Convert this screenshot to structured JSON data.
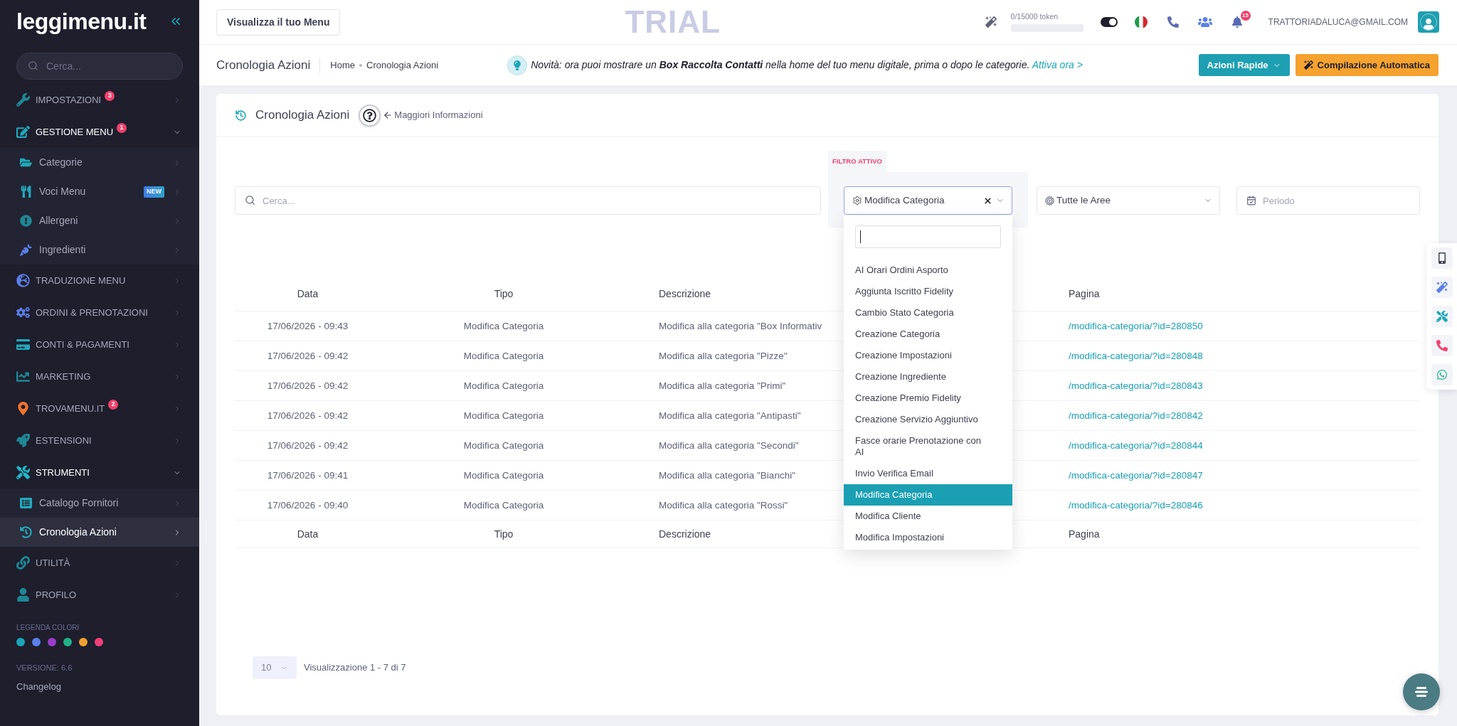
{
  "sidebar": {
    "logo": "leggimenu.it",
    "search": {
      "placeholder": "Cerca..."
    },
    "items": [
      {
        "label": "IMPOSTAZIONI",
        "badge": "3",
        "expanded": false
      },
      {
        "label": "GESTIONE MENU",
        "badge": "1",
        "expanded": true,
        "children": [
          {
            "label": "Categorie",
            "selected": false
          },
          {
            "label": "Voci Menu",
            "tag": "NEW",
            "selected": false
          },
          {
            "label": "Allergeni",
            "selected": false
          },
          {
            "label": "Ingredienti",
            "selected": false
          }
        ]
      },
      {
        "label": "TRADUZIONE MENU",
        "expanded": false
      },
      {
        "label": "ORDINI & PRENOTAZIONI",
        "expanded": false
      },
      {
        "label": "CONTI & PAGAMENTI",
        "expanded": false
      },
      {
        "label": "MARKETING",
        "expanded": false
      },
      {
        "label": "TROVAMENU.IT",
        "badge": "2",
        "expanded": false
      },
      {
        "label": "ESTENSIONI",
        "expanded": false
      },
      {
        "label": "STRUMENTI",
        "expanded": true,
        "children": [
          {
            "label": "Catalogo Fornitori",
            "selected": false
          },
          {
            "label": "Cronologia Azioni",
            "selected": true
          }
        ]
      },
      {
        "label": "UTILITÀ",
        "expanded": false
      },
      {
        "label": "PROFILO",
        "expanded": false
      }
    ],
    "legend": {
      "title": "LEGENDA COLORI",
      "colors": [
        {
          "color": "#1ba5b8"
        },
        {
          "color": "#5b7fe8"
        },
        {
          "color": "#9b3cc9"
        },
        {
          "color": "#22b38a"
        },
        {
          "color": "#f0a030"
        },
        {
          "color": "#f0407a"
        }
      ]
    },
    "version": "VERSIONE: 6.6",
    "changelog": "Changelog"
  },
  "top_bar": {
    "view_menu_button": "Visualizza il tuo Menu",
    "trial_label": "TRIAL",
    "tokens": {
      "text": "0/15000 token"
    },
    "theme_toggle": {
      "on": true
    },
    "notifications": {
      "badge": "15"
    },
    "user_email": "TRATTORIADALUCA@GMAIL.COM"
  },
  "sub_header": {
    "title": "Cronologia Azioni",
    "breadcrumbs": [
      "Home",
      "Cronologia Azioni"
    ],
    "notice": {
      "text": "Novità: ora puoi mostrare un **Box Raccolta Contatti** nella home del tuo menu digitale, prima o dopo le categorie.",
      "link": "Attiva ora >"
    },
    "actions": [
      {
        "label": "Azioni Rapide",
        "kind": "dropdown"
      },
      {
        "label": "Compilazione Automatica",
        "kind": "magic"
      }
    ]
  },
  "card": {
    "title": "Cronologia Azioni",
    "help_link": "Maggiori Informazioni",
    "filters": {
      "search": {
        "placeholder": "Cerca..."
      },
      "active_label": "FILTRO ATTIVO",
      "type_select": {
        "value": "Modifica Categoria",
        "open": true,
        "options": [
          {
            "label": "AI Orari Ordini Asporto",
            "selected": false
          },
          {
            "label": "Aggiunta Iscritto Fidelity",
            "selected": false
          },
          {
            "label": "Cambio Stato Categoria",
            "selected": false
          },
          {
            "label": "Creazione Categoria",
            "selected": false
          },
          {
            "label": "Creazione Impostazioni",
            "selected": false
          },
          {
            "label": "Creazione Ingrediente",
            "selected": false
          },
          {
            "label": "Creazione Premio Fidelity",
            "selected": false
          },
          {
            "label": "Creazione Servizio Aggiuntivo",
            "selected": false
          },
          {
            "label": "Fasce orarie Prenotazione con AI",
            "selected": false
          },
          {
            "label": "Invio Verifica Email",
            "selected": false
          },
          {
            "label": "Modifica Categoria",
            "selected": true
          },
          {
            "label": "Modifica Cliente",
            "selected": false
          },
          {
            "label": "Modifica Impostazioni",
            "selected": false
          }
        ]
      },
      "area_select": {
        "value": "Tutte le Aree"
      },
      "period": {
        "placeholder": "Periodo"
      }
    },
    "table": {
      "columns": [
        "Data",
        "Tipo",
        "Descrizione",
        "Pagina"
      ],
      "rows": [
        {
          "date": "17/06/2026 - 09:43",
          "type": "Modifica Categoria",
          "description": "Modifica alla categoria \"Box Informativ",
          "page": "/modifica-categoria/?id=280850"
        },
        {
          "date": "17/06/2026 - 09:42",
          "type": "Modifica Categoria",
          "description": "Modifica alla categoria \"Pizze\"",
          "page": "/modifica-categoria/?id=280848"
        },
        {
          "date": "17/06/2026 - 09:42",
          "type": "Modifica Categoria",
          "description": "Modifica alla categoria \"Primi\"",
          "page": "/modifica-categoria/?id=280843"
        },
        {
          "date": "17/06/2026 - 09:42",
          "type": "Modifica Categoria",
          "description": "Modifica alla categoria \"Antipasti\"",
          "page": "/modifica-categoria/?id=280842"
        },
        {
          "date": "17/06/2026 - 09:42",
          "type": "Modifica Categoria",
          "description": "Modifica alla categoria \"Secondi\"",
          "page": "/modifica-categoria/?id=280844"
        },
        {
          "date": "17/06/2026 - 09:41",
          "type": "Modifica Categoria",
          "description": "Modifica alla categoria \"Bianchi\"",
          "page": "/modifica-categoria/?id=280847"
        },
        {
          "date": "17/06/2026 - 09:40",
          "type": "Modifica Categoria",
          "description": "Modifica alla categoria \"Rossi\"",
          "page": "/modifica-categoria/?id=280846"
        }
      ],
      "footer_columns": [
        "Data",
        "Tipo",
        "Descrizione",
        "Pagina"
      ]
    },
    "pagination": {
      "page_size": "10",
      "info": "Visualizzazione 1 - 7 di 7"
    }
  }
}
